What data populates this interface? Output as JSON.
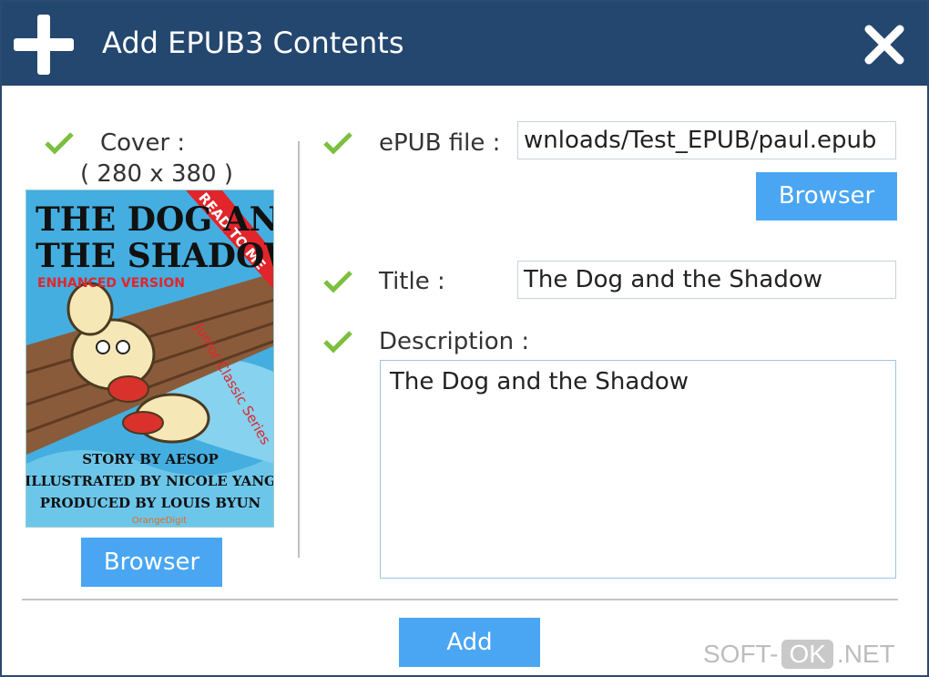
{
  "dialog": {
    "title": "Add EPUB3 Contents"
  },
  "cover": {
    "label": "Cover :",
    "size": "( 280 x 380 )",
    "image": {
      "title_line1": "THE DOG AND",
      "title_line2": "THE SHADOW",
      "subtitle": "ENHANCED VERSION",
      "ribbon": "READ TO ME",
      "series": "Junior Classic Series",
      "credit1": "STORY BY AESOP",
      "credit2": "ILLUSTRATED BY NICOLE YANG",
      "credit3": "PRODUCED BY LOUIS BYUN",
      "brand": "OrangeDigit"
    },
    "browse_label": "Browser"
  },
  "epub": {
    "label": "ePUB file :",
    "value": "wnloads/Test_EPUB/paul.epub",
    "browse_label": "Browser"
  },
  "title_field": {
    "label": "Title :",
    "value": "The Dog and the Shadow"
  },
  "description": {
    "label": "Description :",
    "value": "The Dog and the Shadow"
  },
  "footer": {
    "add_label": "Add"
  },
  "watermark": {
    "left": "SOFT-",
    "mid": "OK",
    "right": ".NET"
  },
  "colors": {
    "titlebar": "#24476f",
    "button": "#4aa6f2",
    "check": "#7cbf3f"
  }
}
